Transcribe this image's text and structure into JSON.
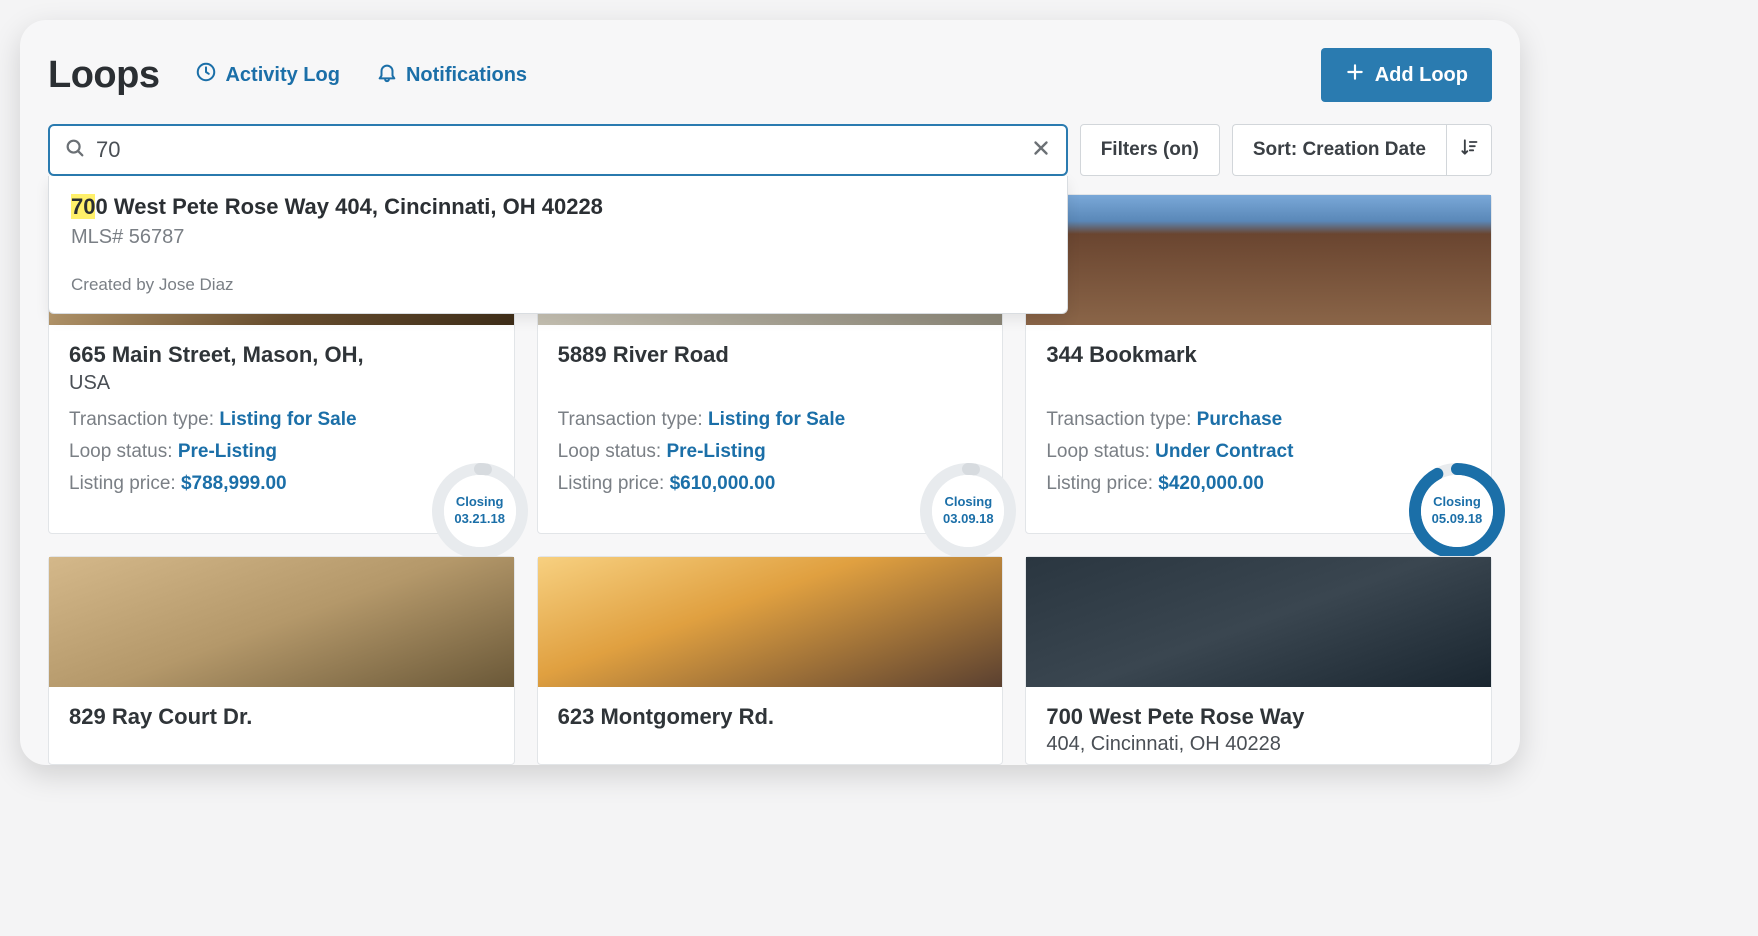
{
  "header": {
    "title": "Loops",
    "activity_log": "Activity Log",
    "notifications": "Notifications",
    "add_loop": "Add Loop"
  },
  "search": {
    "value": "70"
  },
  "suggestion": {
    "highlight": "70",
    "rest": "0 West Pete Rose Way 404, Cincinnati, OH 40228",
    "mls": "MLS# 56787",
    "created_by": "Created by Jose Diaz"
  },
  "filters_btn": "Filters (on)",
  "sort_btn": "Sort: Creation Date",
  "cards": [
    {
      "title": "665 Main Street, Mason, OH,",
      "sub": "USA",
      "transaction_label": "Transaction type:",
      "transaction_value": "Listing for Sale",
      "status_label": "Loop status:",
      "status_value": "Pre-Listing",
      "price_label": "Listing price:",
      "price_value": "$788,999.00",
      "ring_label": "Closing",
      "ring_date": "03.21.18",
      "ring_pct": 2,
      "ring_color": "#d7dbdf"
    },
    {
      "title": "5889 River Road",
      "sub": "",
      "transaction_label": "Transaction type:",
      "transaction_value": "Listing for Sale",
      "status_label": "Loop status:",
      "status_value": "Pre-Listing",
      "price_label": "Listing price:",
      "price_value": "$610,000.00",
      "ring_label": "Closing",
      "ring_date": "03.09.18",
      "ring_pct": 2,
      "ring_color": "#d7dbdf"
    },
    {
      "title": "344 Bookmark",
      "sub": "",
      "transaction_label": "Transaction type:",
      "transaction_value": "Purchase",
      "status_label": "Loop status:",
      "status_value": "Under Contract",
      "price_label": "Listing price:",
      "price_value": "$420,000.00",
      "ring_label": "Closing",
      "ring_date": "05.09.18",
      "ring_pct": 92,
      "ring_color": "#1b6fa8"
    }
  ],
  "row2": [
    {
      "title": "829 Ray Court Dr.",
      "sub": ""
    },
    {
      "title": "623 Montgomery Rd.",
      "sub": ""
    },
    {
      "title": "700 West Pete Rose Way",
      "sub": "404, Cincinnati, OH 40228"
    }
  ]
}
